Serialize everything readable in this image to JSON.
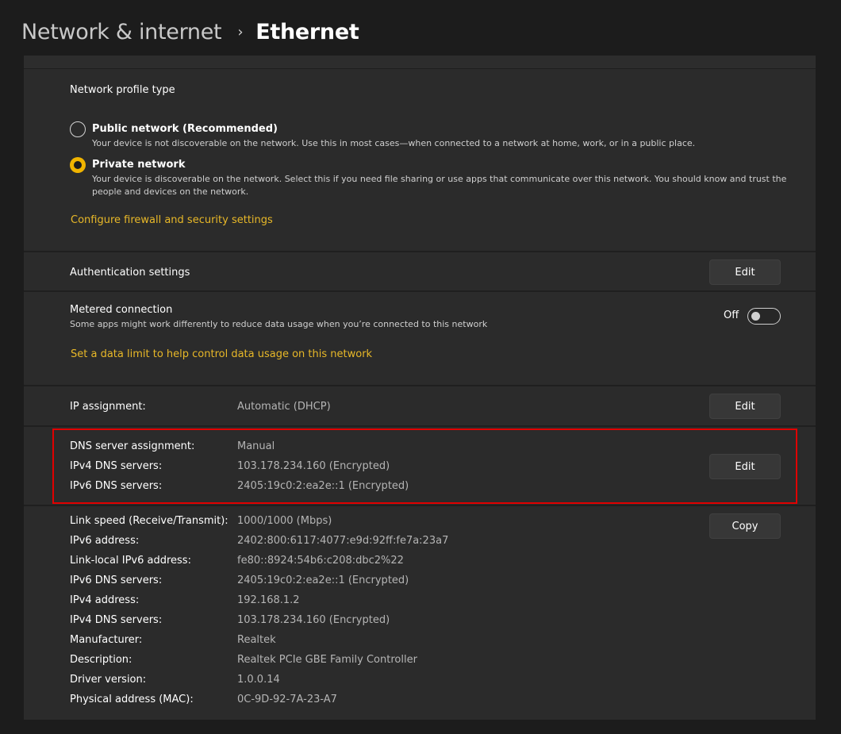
{
  "breadcrumb": {
    "parent": "Network & internet",
    "separator": "›",
    "current": "Ethernet"
  },
  "network_profile": {
    "title": "Network profile type",
    "options": [
      {
        "label": "Public network (Recommended)",
        "description": "Your device is not discoverable on the network. Use this in most cases—when connected to a network at home, work, or in a public place.",
        "selected": false
      },
      {
        "label": "Private network",
        "description_line1": "Your device is discoverable on the network. Select this if you need file sharing or use apps that communicate over this network. You should know and trust the",
        "description_line2": "people and devices on the network.",
        "selected": true
      }
    ],
    "firewall_link": "Configure firewall and security settings"
  },
  "authentication": {
    "label": "Authentication settings",
    "button": "Edit"
  },
  "metered": {
    "title": "Metered connection",
    "description": "Some apps might work differently to reduce data usage when you’re connected to this network",
    "toggle_state": "Off",
    "toggle_on": false,
    "data_limit_link": "Set a data limit to help control data usage on this network"
  },
  "ip_assignment": {
    "label": "IP assignment:",
    "value": "Automatic (DHCP)",
    "button": "Edit"
  },
  "dns_assignment": {
    "rows": [
      {
        "label": "DNS server assignment:",
        "value": "Manual"
      },
      {
        "label": "IPv4 DNS servers:",
        "value": "103.178.234.160 (Encrypted)"
      },
      {
        "label": "IPv6 DNS servers:",
        "value": "2405:19c0:2:ea2e::1 (Encrypted)"
      }
    ],
    "button": "Edit"
  },
  "properties": {
    "button": "Copy",
    "rows": [
      {
        "label": "Link speed (Receive/Transmit):",
        "value": "1000/1000 (Mbps)"
      },
      {
        "label": "IPv6 address:",
        "value": "2402:800:6117:4077:e9d:92ff:fe7a:23a7"
      },
      {
        "label": "Link-local IPv6 address:",
        "value": "fe80::8924:54b6:c208:dbc2%22"
      },
      {
        "label": "IPv6 DNS servers:",
        "value": "2405:19c0:2:ea2e::1 (Encrypted)"
      },
      {
        "label": "IPv4 address:",
        "value": "192.168.1.2"
      },
      {
        "label": "IPv4 DNS servers:",
        "value": "103.178.234.160 (Encrypted)"
      },
      {
        "label": "Manufacturer:",
        "value": "Realtek"
      },
      {
        "label": "Description:",
        "value": "Realtek PCIe GBE Family Controller"
      },
      {
        "label": "Driver version:",
        "value": "1.0.0.14"
      },
      {
        "label": "Physical address (MAC):",
        "value": "0C-9D-92-7A-23-A7"
      }
    ]
  },
  "colors": {
    "accent": "#f0b400",
    "link": "#e8b828",
    "highlight_border": "#e00000",
    "panel": "#2b2b2b",
    "background": "#1c1c1c"
  }
}
